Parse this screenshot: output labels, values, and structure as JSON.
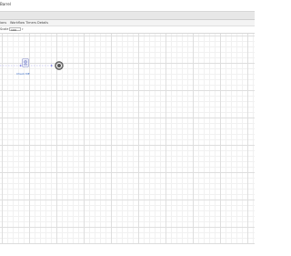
{
  "window": {
    "title": "Barrel"
  },
  "tabs": [
    {
      "label": "ions"
    },
    {
      "label": "Workflow Timers"
    },
    {
      "label": "Details"
    }
  ],
  "toolbar": {
    "label": "Scale",
    "zoom_value": "100"
  },
  "diagram": {
    "task_label": "Check ME"
  }
}
